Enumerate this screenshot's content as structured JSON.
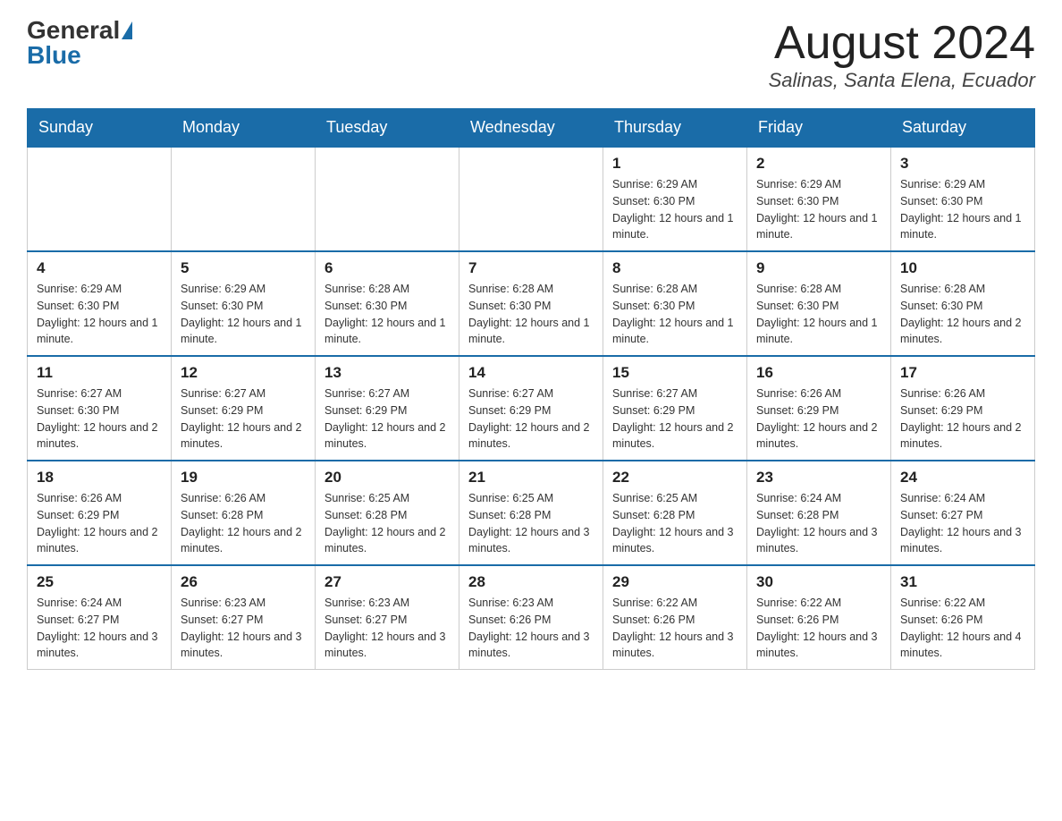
{
  "header": {
    "logo_general": "General",
    "logo_blue": "Blue",
    "month_title": "August 2024",
    "location": "Salinas, Santa Elena, Ecuador"
  },
  "days_of_week": [
    "Sunday",
    "Monday",
    "Tuesday",
    "Wednesday",
    "Thursday",
    "Friday",
    "Saturday"
  ],
  "weeks": [
    [
      {
        "day": "",
        "info": ""
      },
      {
        "day": "",
        "info": ""
      },
      {
        "day": "",
        "info": ""
      },
      {
        "day": "",
        "info": ""
      },
      {
        "day": "1",
        "info": "Sunrise: 6:29 AM\nSunset: 6:30 PM\nDaylight: 12 hours and 1 minute."
      },
      {
        "day": "2",
        "info": "Sunrise: 6:29 AM\nSunset: 6:30 PM\nDaylight: 12 hours and 1 minute."
      },
      {
        "day": "3",
        "info": "Sunrise: 6:29 AM\nSunset: 6:30 PM\nDaylight: 12 hours and 1 minute."
      }
    ],
    [
      {
        "day": "4",
        "info": "Sunrise: 6:29 AM\nSunset: 6:30 PM\nDaylight: 12 hours and 1 minute."
      },
      {
        "day": "5",
        "info": "Sunrise: 6:29 AM\nSunset: 6:30 PM\nDaylight: 12 hours and 1 minute."
      },
      {
        "day": "6",
        "info": "Sunrise: 6:28 AM\nSunset: 6:30 PM\nDaylight: 12 hours and 1 minute."
      },
      {
        "day": "7",
        "info": "Sunrise: 6:28 AM\nSunset: 6:30 PM\nDaylight: 12 hours and 1 minute."
      },
      {
        "day": "8",
        "info": "Sunrise: 6:28 AM\nSunset: 6:30 PM\nDaylight: 12 hours and 1 minute."
      },
      {
        "day": "9",
        "info": "Sunrise: 6:28 AM\nSunset: 6:30 PM\nDaylight: 12 hours and 1 minute."
      },
      {
        "day": "10",
        "info": "Sunrise: 6:28 AM\nSunset: 6:30 PM\nDaylight: 12 hours and 2 minutes."
      }
    ],
    [
      {
        "day": "11",
        "info": "Sunrise: 6:27 AM\nSunset: 6:30 PM\nDaylight: 12 hours and 2 minutes."
      },
      {
        "day": "12",
        "info": "Sunrise: 6:27 AM\nSunset: 6:29 PM\nDaylight: 12 hours and 2 minutes."
      },
      {
        "day": "13",
        "info": "Sunrise: 6:27 AM\nSunset: 6:29 PM\nDaylight: 12 hours and 2 minutes."
      },
      {
        "day": "14",
        "info": "Sunrise: 6:27 AM\nSunset: 6:29 PM\nDaylight: 12 hours and 2 minutes."
      },
      {
        "day": "15",
        "info": "Sunrise: 6:27 AM\nSunset: 6:29 PM\nDaylight: 12 hours and 2 minutes."
      },
      {
        "day": "16",
        "info": "Sunrise: 6:26 AM\nSunset: 6:29 PM\nDaylight: 12 hours and 2 minutes."
      },
      {
        "day": "17",
        "info": "Sunrise: 6:26 AM\nSunset: 6:29 PM\nDaylight: 12 hours and 2 minutes."
      }
    ],
    [
      {
        "day": "18",
        "info": "Sunrise: 6:26 AM\nSunset: 6:29 PM\nDaylight: 12 hours and 2 minutes."
      },
      {
        "day": "19",
        "info": "Sunrise: 6:26 AM\nSunset: 6:28 PM\nDaylight: 12 hours and 2 minutes."
      },
      {
        "day": "20",
        "info": "Sunrise: 6:25 AM\nSunset: 6:28 PM\nDaylight: 12 hours and 2 minutes."
      },
      {
        "day": "21",
        "info": "Sunrise: 6:25 AM\nSunset: 6:28 PM\nDaylight: 12 hours and 3 minutes."
      },
      {
        "day": "22",
        "info": "Sunrise: 6:25 AM\nSunset: 6:28 PM\nDaylight: 12 hours and 3 minutes."
      },
      {
        "day": "23",
        "info": "Sunrise: 6:24 AM\nSunset: 6:28 PM\nDaylight: 12 hours and 3 minutes."
      },
      {
        "day": "24",
        "info": "Sunrise: 6:24 AM\nSunset: 6:27 PM\nDaylight: 12 hours and 3 minutes."
      }
    ],
    [
      {
        "day": "25",
        "info": "Sunrise: 6:24 AM\nSunset: 6:27 PM\nDaylight: 12 hours and 3 minutes."
      },
      {
        "day": "26",
        "info": "Sunrise: 6:23 AM\nSunset: 6:27 PM\nDaylight: 12 hours and 3 minutes."
      },
      {
        "day": "27",
        "info": "Sunrise: 6:23 AM\nSunset: 6:27 PM\nDaylight: 12 hours and 3 minutes."
      },
      {
        "day": "28",
        "info": "Sunrise: 6:23 AM\nSunset: 6:26 PM\nDaylight: 12 hours and 3 minutes."
      },
      {
        "day": "29",
        "info": "Sunrise: 6:22 AM\nSunset: 6:26 PM\nDaylight: 12 hours and 3 minutes."
      },
      {
        "day": "30",
        "info": "Sunrise: 6:22 AM\nSunset: 6:26 PM\nDaylight: 12 hours and 3 minutes."
      },
      {
        "day": "31",
        "info": "Sunrise: 6:22 AM\nSunset: 6:26 PM\nDaylight: 12 hours and 4 minutes."
      }
    ]
  ]
}
